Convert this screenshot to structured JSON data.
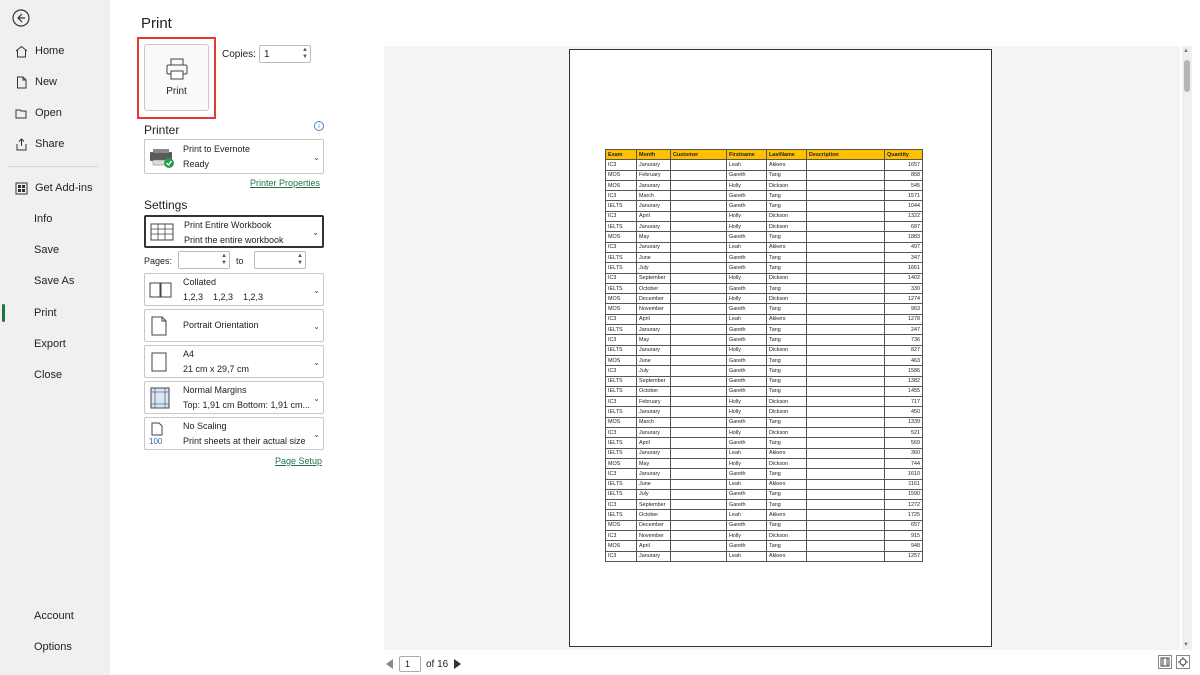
{
  "nav": {
    "items": [
      {
        "label": "Home",
        "icon": "home-icon"
      },
      {
        "label": "New",
        "icon": "new-document-icon"
      },
      {
        "label": "Open",
        "icon": "folder-open-icon"
      },
      {
        "label": "Share",
        "icon": "share-icon"
      },
      {
        "label": "Get Add-ins",
        "icon": "add-ins-icon"
      },
      {
        "label": "Info"
      },
      {
        "label": "Save"
      },
      {
        "label": "Save As"
      },
      {
        "label": "Print"
      },
      {
        "label": "Export"
      },
      {
        "label": "Close"
      }
    ],
    "bottom": [
      {
        "label": "Account"
      },
      {
        "label": "Options"
      }
    ],
    "active": "Print",
    "accent_color": "#217346"
  },
  "print_panel": {
    "title": "Print",
    "print_button_label": "Print",
    "copies_label": "Copies:",
    "copies_value": "1",
    "printer_section": "Printer",
    "printer_name": "Print to Evernote",
    "printer_status": "Ready",
    "printer_properties_link": "Printer Properties",
    "settings_section": "Settings",
    "what_to_print": {
      "title": "Print Entire Workbook",
      "subtitle": "Print the entire workbook"
    },
    "pages_label": "Pages:",
    "to_label": "to",
    "collation": {
      "title": "Collated",
      "subtitle": "1,2,3    1,2,3    1,2,3"
    },
    "orientation": {
      "title": "Portrait Orientation"
    },
    "paper": {
      "title": "A4",
      "subtitle": "21 cm x 29,7 cm"
    },
    "margins": {
      "title": "Normal Margins",
      "subtitle": "Top: 1,91 cm Bottom: 1,91 cm..."
    },
    "scaling": {
      "title": "No Scaling",
      "subtitle": "Print sheets at their actual size",
      "icon_text": "100"
    },
    "page_setup_link": "Page Setup",
    "highlight_color": "#e53935"
  },
  "preview": {
    "headers": [
      "Exam",
      "Month",
      "Customer",
      "Firstname",
      "LastName",
      "Description",
      "Quantity"
    ],
    "header_color": "#ffc000",
    "rows": [
      [
        "IC3",
        "Janurary",
        "",
        "Leah",
        "Akkers",
        "",
        "1657"
      ],
      [
        "MOS",
        "February",
        "",
        "Gareth",
        "Tang",
        "",
        "868"
      ],
      [
        "MOS",
        "Janurary",
        "",
        "Holly",
        "Dickson",
        "",
        "545"
      ],
      [
        "IC3",
        "March",
        "",
        "Gareth",
        "Tang",
        "",
        "1571"
      ],
      [
        "IELTS",
        "Janurary",
        "",
        "Gareth",
        "Tang",
        "",
        "1044"
      ],
      [
        "IC3",
        "April",
        "",
        "Holly",
        "Dickson",
        "",
        "1322"
      ],
      [
        "IELTS",
        "Janurary",
        "",
        "Holly",
        "Dickson",
        "",
        "687"
      ],
      [
        "MOS",
        "May",
        "",
        "Gareth",
        "Tang",
        "",
        "1883"
      ],
      [
        "IC3",
        "Janurary",
        "",
        "Leah",
        "Akkers",
        "",
        "497"
      ],
      [
        "IELTS",
        "June",
        "",
        "Gareth",
        "Tang",
        "",
        "347"
      ],
      [
        "IELTS",
        "July",
        "",
        "Gareth",
        "Tang",
        "",
        "1661"
      ],
      [
        "IC3",
        "September",
        "",
        "Holly",
        "Dickson",
        "",
        "1402"
      ],
      [
        "IELTS",
        "October",
        "",
        "Gareth",
        "Tang",
        "",
        "330"
      ],
      [
        "MOS",
        "December",
        "",
        "Holly",
        "Dickson",
        "",
        "1274"
      ],
      [
        "MOS",
        "November",
        "",
        "Gareth",
        "Tang",
        "",
        "963"
      ],
      [
        "IC3",
        "April",
        "",
        "Leah",
        "Akkers",
        "",
        "1278"
      ],
      [
        "IELTS",
        "Janurary",
        "",
        "Gareth",
        "Tang",
        "",
        "247"
      ],
      [
        "IC3",
        "May",
        "",
        "Gareth",
        "Tang",
        "",
        "736"
      ],
      [
        "IELTS",
        "Janurary",
        "",
        "Holly",
        "Dickson",
        "",
        "827"
      ],
      [
        "MOS",
        "June",
        "",
        "Gareth",
        "Tang",
        "",
        "463"
      ],
      [
        "IC3",
        "July",
        "",
        "Gareth",
        "Tang",
        "",
        "1586"
      ],
      [
        "IELTS",
        "September",
        "",
        "Gareth",
        "Tang",
        "",
        "1382"
      ],
      [
        "IELTS",
        "October",
        "",
        "Gareth",
        "Tang",
        "",
        "1455"
      ],
      [
        "IC3",
        "February",
        "",
        "Holly",
        "Dickson",
        "",
        "717"
      ],
      [
        "IELTS",
        "Janurary",
        "",
        "Holly",
        "Dickson",
        "",
        "450"
      ],
      [
        "MOS",
        "March",
        "",
        "Gareth",
        "Tang",
        "",
        "1339"
      ],
      [
        "IC3",
        "Janurary",
        "",
        "Holly",
        "Dickson",
        "",
        "521"
      ],
      [
        "IELTS",
        "April",
        "",
        "Gareth",
        "Tang",
        "",
        "569"
      ],
      [
        "IELTS",
        "Janurary",
        "",
        "Leah",
        "Akkers",
        "",
        "360"
      ],
      [
        "MOS",
        "May",
        "",
        "Holly",
        "Dickson",
        "",
        "744"
      ],
      [
        "IC3",
        "Janurary",
        "",
        "Gareth",
        "Tang",
        "",
        "1610"
      ],
      [
        "IELTS",
        "June",
        "",
        "Leah",
        "Akkers",
        "",
        "1161"
      ],
      [
        "IELTS",
        "July",
        "",
        "Gareth",
        "Tang",
        "",
        "1590"
      ],
      [
        "IC3",
        "September",
        "",
        "Gareth",
        "Tang",
        "",
        "1272"
      ],
      [
        "IELTS",
        "October",
        "",
        "Leah",
        "Akkers",
        "",
        "1725"
      ],
      [
        "MOS",
        "December",
        "",
        "Gareth",
        "Tang",
        "",
        "657"
      ],
      [
        "IC3",
        "November",
        "",
        "Holly",
        "Dickson",
        "",
        "915"
      ],
      [
        "MOS",
        "April",
        "",
        "Gareth",
        "Tang",
        "",
        "948"
      ],
      [
        "IC3",
        "Janurary",
        "",
        "Leah",
        "Akkers",
        "",
        "1257"
      ]
    ]
  },
  "pager": {
    "current_page": "1",
    "of_label": "of 16"
  }
}
